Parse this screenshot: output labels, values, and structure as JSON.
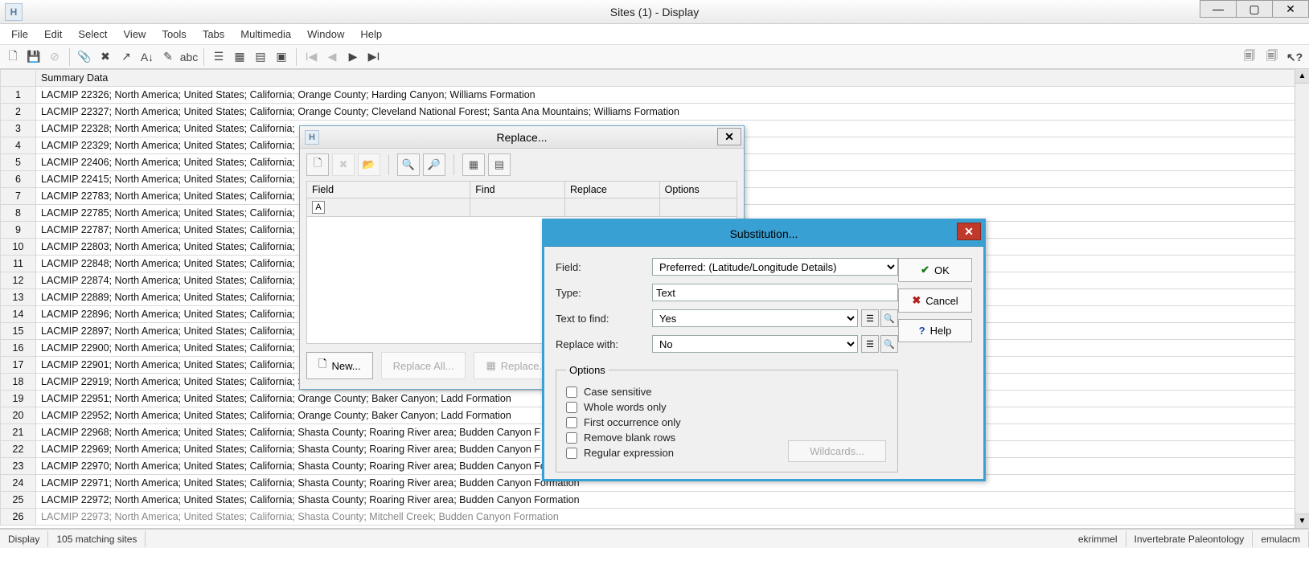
{
  "window": {
    "title": "Sites (1) - Display"
  },
  "menu": [
    "File",
    "Edit",
    "Select",
    "View",
    "Tools",
    "Tabs",
    "Multimedia",
    "Window",
    "Help"
  ],
  "status": {
    "mode": "Display",
    "match": "105 matching sites",
    "user": "ekrimmel",
    "group": "Invertebrate Paleontology",
    "server": "emulacm"
  },
  "grid": {
    "header": "Summary Data",
    "rows": [
      "LACMIP 22326; North America; United States; California; Orange County; Harding Canyon; Williams Formation",
      "LACMIP 22327; North America; United States; California; Orange County; Cleveland National Forest; Santa Ana Mountains; Williams Formation",
      "LACMIP 22328; North America; United States; California;",
      "LACMIP 22329; North America; United States; California;",
      "LACMIP 22406; North America; United States; California;",
      "LACMIP 22415; North America; United States; California;",
      "LACMIP 22783; North America; United States; California;",
      "LACMIP 22785; North America; United States; California;",
      "LACMIP 22787; North America; United States; California;",
      "LACMIP 22803; North America; United States; California;",
      "LACMIP 22848; North America; United States; California;",
      "LACMIP 22874; North America; United States; California;",
      "LACMIP 22889; North America; United States; California;",
      "LACMIP 22896; North America; United States; California;",
      "LACMIP 22897; North America; United States; California;",
      "LACMIP 22900; North America; United States; California;",
      "LACMIP 22901; North America; United States; California;",
      "LACMIP 22919; North America; United States; California; Shasta County; Mitchell Creek; Budden Canyon Forma",
      "LACMIP 22951; North America; United States; California; Orange County; Baker Canyon; Ladd Formation",
      "LACMIP 22952; North America; United States; California; Orange County; Baker Canyon; Ladd Formation",
      "LACMIP 22968; North America; United States; California; Shasta County; Roaring River area; Budden Canyon F",
      "LACMIP 22969; North America; United States; California; Shasta County; Roaring River area; Budden Canyon F",
      "LACMIP 22970; North America; United States; California; Shasta County; Roaring River area; Budden Canyon Formation",
      "LACMIP 22971; North America; United States; California; Shasta County; Roaring River area; Budden Canyon Formation",
      "LACMIP 22972; North America; United States; California; Shasta County; Roaring River area; Budden Canyon Formation",
      "LACMIP 22973; North America; United States; California; Shasta County; Mitchell Creek; Budden Canyon Formation"
    ]
  },
  "replaceDialog": {
    "title": "Replace...",
    "columns": [
      "Field",
      "Find",
      "Replace",
      "Options"
    ],
    "fieldIcon": "A",
    "buttons": {
      "new": "New...",
      "replaceAll": "Replace All...",
      "replace": "Replace..."
    }
  },
  "subDialog": {
    "title": "Substitution...",
    "labels": {
      "field": "Field:",
      "type": "Type:",
      "textToFind": "Text to find:",
      "replaceWith": "Replace with:",
      "options": "Options",
      "case": "Case sensitive",
      "whole": "Whole words only",
      "first": "First occurrence only",
      "remove": "Remove blank rows",
      "regex": "Regular expression",
      "wildcards": "Wildcards..."
    },
    "values": {
      "field": "Preferred: (Latitude/Longitude Details)",
      "type": "Text",
      "find": "Yes",
      "replace": "No"
    },
    "buttons": {
      "ok": "OK",
      "cancel": "Cancel",
      "help": "Help"
    }
  }
}
